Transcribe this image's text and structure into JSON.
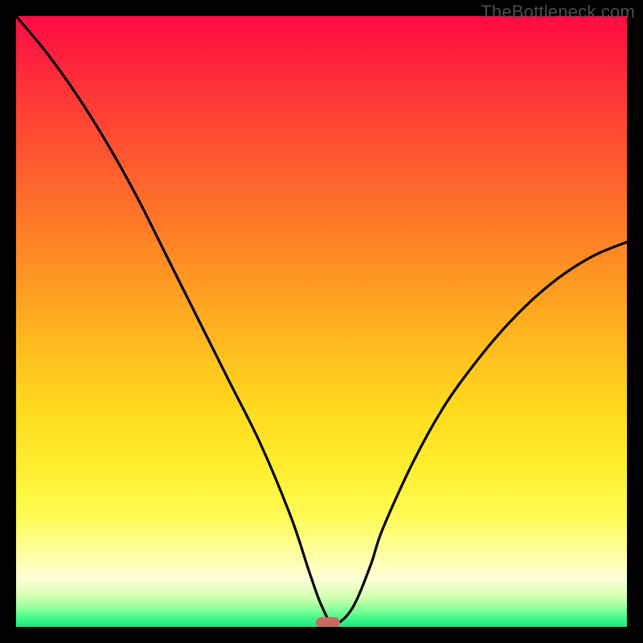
{
  "watermark": "TheBottleneck.com",
  "chart_data": {
    "type": "line",
    "title": "",
    "xlabel": "",
    "ylabel": "",
    "xlim": [
      0,
      100
    ],
    "ylim": [
      0,
      100
    ],
    "x": [
      0,
      5,
      10,
      15,
      20,
      25,
      30,
      35,
      40,
      45,
      48,
      50,
      52,
      55,
      58,
      60,
      65,
      70,
      75,
      80,
      85,
      90,
      95,
      100
    ],
    "values": [
      100,
      94,
      87,
      79,
      70,
      60,
      50,
      40,
      30,
      18,
      9,
      3.5,
      0.5,
      3,
      10,
      16,
      27,
      36,
      43,
      49,
      54,
      58,
      61,
      63
    ],
    "series": [
      {
        "name": "bottleneck-curve",
        "color": "#000000"
      }
    ],
    "marker": {
      "x": 51,
      "y": 0.6,
      "label": "optimal-point",
      "color": "#c96a62"
    },
    "background_gradient": {
      "top": "#ff0b44",
      "mid": "#ffee2e",
      "bottom": "#17e77c"
    }
  }
}
